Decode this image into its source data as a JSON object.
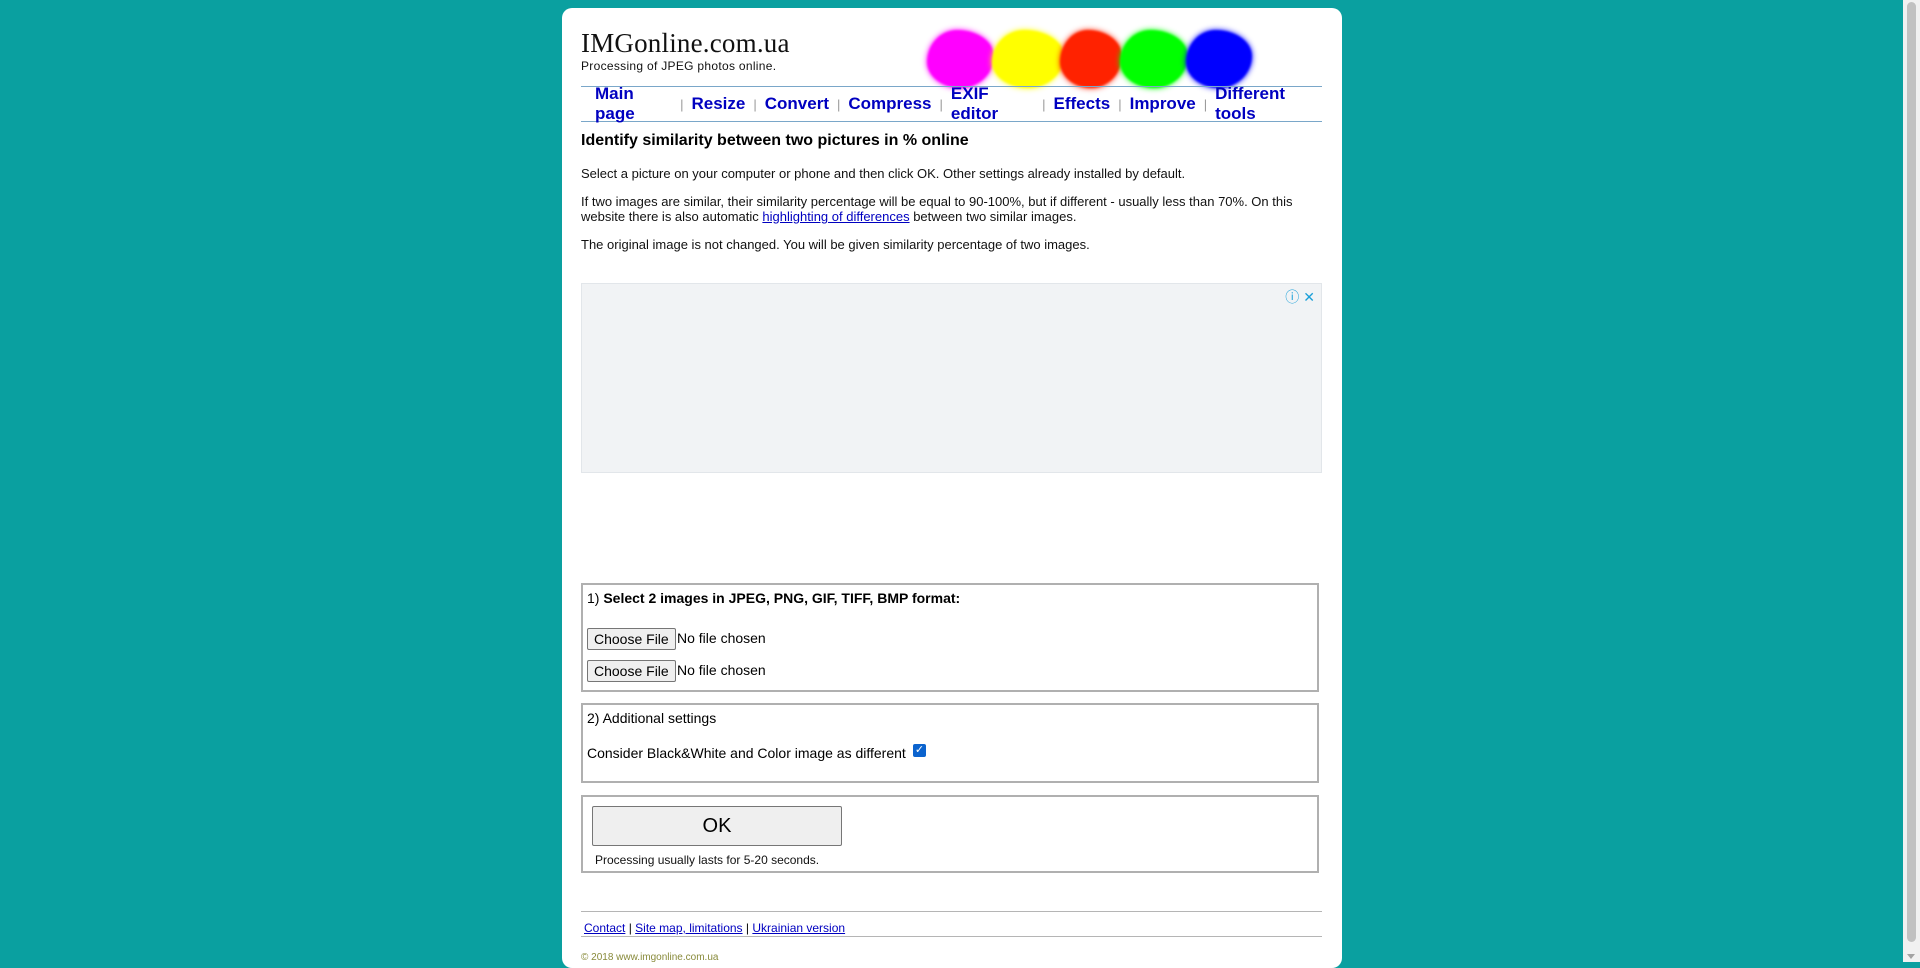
{
  "header": {
    "site_name": "IMGonline.com.ua",
    "tagline": "Processing of JPEG photos online.",
    "blob_colors": [
      "#ff00ff",
      "#ffff00",
      "#ff2200",
      "#00ff00",
      "#0000ff"
    ]
  },
  "nav": {
    "items": [
      {
        "label": "Main page"
      },
      {
        "label": "Resize"
      },
      {
        "label": "Convert"
      },
      {
        "label": "Compress"
      },
      {
        "label": "EXIF editor"
      },
      {
        "label": "Effects"
      },
      {
        "label": "Improve"
      },
      {
        "label": "Different tools"
      }
    ],
    "separator": "|"
  },
  "main": {
    "title": "Identify similarity between two pictures in % online",
    "p1": "Select a picture on your computer or phone and then click OK. Other settings already installed by default.",
    "p2_before": "If two images are similar, their similarity percentage will be equal to 90-100%, but if different - usually less than 70%. On this website there is also automatic ",
    "p2_link": "highlighting of differences",
    "p2_after": " between two similar images.",
    "p3": "The original image is not changed. You will be given similarity percentage of two images."
  },
  "ad": {
    "info_icon": "info-icon",
    "close_icon": "close-icon",
    "info_glyph": "ⓘ",
    "close_glyph": "✕"
  },
  "step1": {
    "number": "1)",
    "label": "Select 2 images in JPEG, PNG, GIF, TIFF, BMP format:",
    "file_button": "Choose File",
    "no_file": "No file chosen"
  },
  "step2": {
    "label": "2) Additional settings",
    "option_label": "Consider Black&White and Color image as different",
    "option_checked": true
  },
  "submit": {
    "ok_label": "OK",
    "hint": "Processing usually lasts for 5-20 seconds."
  },
  "footer": {
    "links": [
      "Contact",
      "Site map, limitations",
      "Ukrainian version"
    ],
    "separator": "|",
    "copyright": "© 2018 www.imgonline.com.ua"
  }
}
